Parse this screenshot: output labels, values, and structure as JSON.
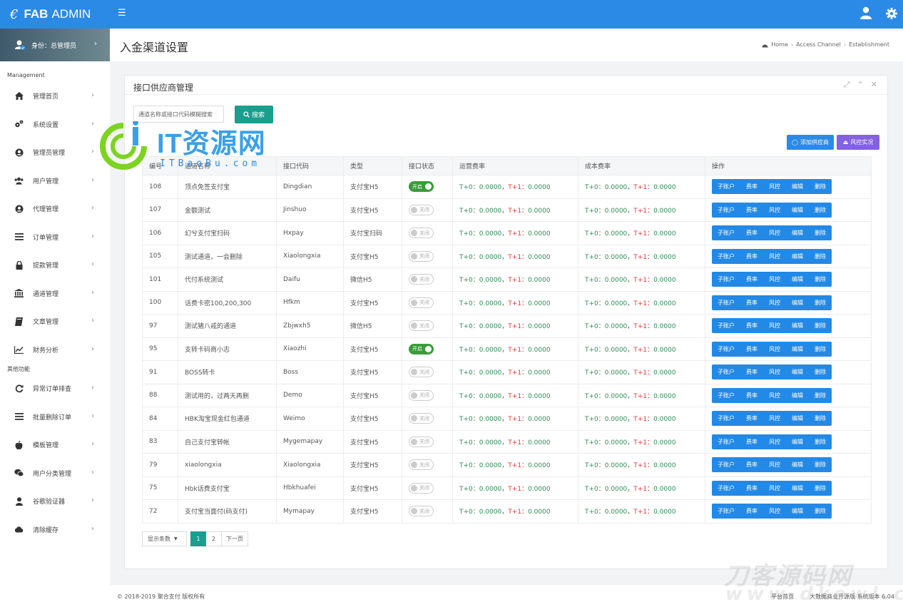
{
  "brand": {
    "strong": "FAB",
    "rest": "ADMIN"
  },
  "sidebar": {
    "profile_label": "身份：总管理员",
    "section_main": "Management",
    "section_other": "其他功能",
    "items": [
      {
        "label": "管理首页",
        "icon": "home-icon"
      },
      {
        "label": "系统设置",
        "icon": "cogs-icon"
      },
      {
        "label": "管理员管理",
        "icon": "user-circle-icon"
      },
      {
        "label": "用户管理",
        "icon": "users-icon"
      },
      {
        "label": "代理管理",
        "icon": "user-circle-icon"
      },
      {
        "label": "订单管理",
        "icon": "list-icon"
      },
      {
        "label": "提款管理",
        "icon": "lock-icon"
      },
      {
        "label": "通道管理",
        "icon": "bank-icon"
      },
      {
        "label": "文章管理",
        "icon": "book-icon"
      },
      {
        "label": "财务分析",
        "icon": "chart-icon"
      }
    ],
    "other_items": [
      {
        "label": "异常订单排查",
        "icon": "refresh-icon"
      },
      {
        "label": "批量删除订单",
        "icon": "list-icon"
      },
      {
        "label": "模板管理",
        "icon": "apple-icon"
      },
      {
        "label": "用户分类管理",
        "icon": "wechat-icon"
      },
      {
        "label": "谷歌验证器",
        "icon": "user-icon"
      },
      {
        "label": "清除缓存",
        "icon": "cloud-icon"
      }
    ]
  },
  "header": {
    "page_title": "入金渠道设置",
    "breadcrumbs": [
      "Home",
      "Access Channel",
      "Establishment"
    ]
  },
  "panel": {
    "title": "接口供应商管理",
    "search_placeholder": "通道名称或接口代码模糊搜索",
    "search_button": "搜索",
    "add_button": "添加供应商",
    "risk_button": "风控实况"
  },
  "watermark": {
    "text": "IT资源网",
    "sub": "ITBaoBu.com",
    "text2": "刀客源码网",
    "sub2": "www.dkewl.com"
  },
  "table": {
    "headers": [
      "编号",
      "通道名称",
      "接口代码",
      "类型",
      "接口状态",
      "运营费率",
      "成本费率",
      "操作"
    ],
    "on_label": "开启",
    "off_label": "关闭",
    "t0_label": "T+0",
    "t1_label": "T+1",
    "rate_value": "0.0000",
    "actions": [
      "子账户",
      "费率",
      "风控",
      "编辑",
      "删除"
    ],
    "rows": [
      {
        "id": "108",
        "name": "顶点免签支付宝",
        "code": "Dingdian",
        "type": "支付宝H5",
        "on": true
      },
      {
        "id": "107",
        "name": "金额测试",
        "code": "Jinshuo",
        "type": "支付宝H5",
        "on": false
      },
      {
        "id": "106",
        "name": "幻兮支付宝扫码",
        "code": "Hxpay",
        "type": "支付宝扫码",
        "on": false
      },
      {
        "id": "105",
        "name": "测试通道，一会删除",
        "code": "Xiaolongxia",
        "type": "支付宝H5",
        "on": false
      },
      {
        "id": "101",
        "name": "代付系统测试",
        "code": "Daifu",
        "type": "微信H5",
        "on": false
      },
      {
        "id": "100",
        "name": "话费卡密100,200,300",
        "code": "Hfkm",
        "type": "支付宝H5",
        "on": false
      },
      {
        "id": "97",
        "name": "测试猪八戒的通道",
        "code": "Zbjwxh5",
        "type": "微信H5",
        "on": false
      },
      {
        "id": "95",
        "name": "支转卡码商小志",
        "code": "Xiaozhi",
        "type": "支付宝H5",
        "on": true
      },
      {
        "id": "91",
        "name": "BOSS转卡",
        "code": "Boss",
        "type": "支付宝H5",
        "on": false
      },
      {
        "id": "88",
        "name": "测试用的，过两天再删",
        "code": "Demo",
        "type": "支付宝H5",
        "on": false
      },
      {
        "id": "84",
        "name": "HBK淘宝现金红包通道",
        "code": "Weimo",
        "type": "支付宝H5",
        "on": false
      },
      {
        "id": "83",
        "name": "自己支付宝转帐",
        "code": "Mygemapay",
        "type": "支付宝H5",
        "on": false
      },
      {
        "id": "79",
        "name": "xiaolongxia",
        "code": "Xiaolongxia",
        "type": "支付宝H5",
        "on": false
      },
      {
        "id": "75",
        "name": "Hbk话费支付宝",
        "code": "Hbkhuafei",
        "type": "支付宝H5",
        "on": false
      },
      {
        "id": "72",
        "name": "支付宝当面付(码支付)",
        "code": "Mymapay",
        "type": "支付宝H5",
        "on": false
      }
    ]
  },
  "pager": {
    "size_label": "显示条数",
    "pages": [
      "1",
      "2"
    ],
    "next": "下一页"
  },
  "footer": {
    "copyright": "© 2018-2019 聚合支付 版权所有",
    "home_link": "平台首页",
    "version": "大数据商业开源版 系统版本 6.04"
  },
  "colors": {
    "topbar": "#2b8ae6",
    "accent_green": "#1a9e8e",
    "action_blue": "#2389e6",
    "risk_purple": "#8361e0"
  }
}
